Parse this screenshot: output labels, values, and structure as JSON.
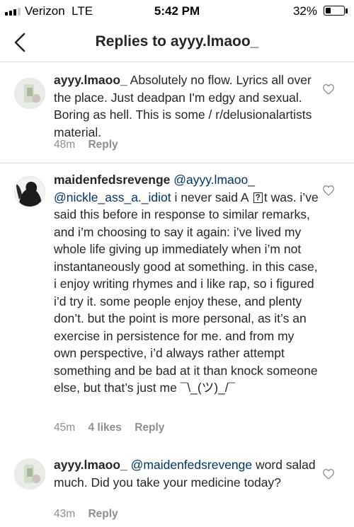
{
  "status_bar": {
    "carrier": "Verizon",
    "network": "LTE",
    "time": "5:42 PM",
    "battery_percent": "32%",
    "battery_level": 0.32,
    "signal_bars_filled": 3,
    "signal_bars_total": 4
  },
  "header": {
    "title": "Replies to ayyy.lmaoo_",
    "back_icon": "chevron-left-icon"
  },
  "comments": [
    {
      "username": "ayyy.lmaoo_",
      "text": "Absolutely no flow. Lyrics all over the place. Just deadpan I'm edgy and sexual. Boring as hell. This is some / r/delusionalartists material.",
      "time": "48m",
      "likes": "",
      "reply_label": "Reply",
      "avatar_icon": "avatar-image"
    },
    {
      "username": "maidenfedsrevenge",
      "mention_1": "@ayyy.lmaoo_",
      "mention_2": "@nickle_ass_a._idiot",
      "text_before_glyph": "i never said A",
      "unknown_glyph": "?",
      "text": "t was. i’ve said this before in response to similar remarks, and i’m choosing to say it again: i’ve lived my whole life giving up immediately when i’m not instantaneously good at something. in this case, i enjoy writing rhymes and i like rap, so i figured i’d try it. some people enjoy these, and plenty don’t. but the point is more personal, as it’s an exercise in persistence for me. and from my own perspective, i’d always rather attempt something and be bad at it than knock someone else, but that’s just me ¯\\_(ツ)_/¯",
      "time": "45m",
      "likes": "4 likes",
      "reply_label": "Reply",
      "avatar_icon": "avatar-image"
    },
    {
      "username": "ayyy.lmaoo_",
      "mention": "@maidenfedsrevenge",
      "text": "word salad much. Did you take your medicine today?",
      "time": "43m",
      "likes": "",
      "reply_label": "Reply",
      "avatar_icon": "avatar-image"
    }
  ],
  "colors": {
    "text": "#262626",
    "meta": "#8e8e8e",
    "mention": "#003569",
    "divider": "#dbdbdb"
  }
}
